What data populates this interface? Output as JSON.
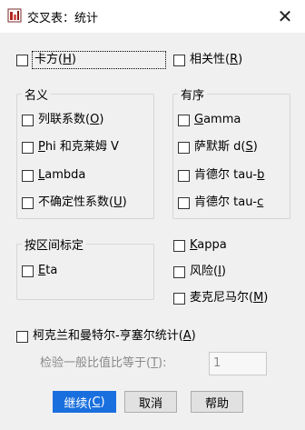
{
  "window": {
    "title": "交叉表：统计",
    "icon": "spss-app-icon"
  },
  "options": {
    "chisq": {
      "text": "卡方(",
      "key": "H",
      "suffix": ")"
    },
    "corr": {
      "text": "相关性(",
      "key": "R",
      "suffix": ")"
    }
  },
  "nominal": {
    "legend": "名义",
    "items": [
      {
        "pre": "列联系数(",
        "key": "O",
        "post": ")"
      },
      {
        "pre": "",
        "key": "P",
        "post": "hi 和克莱姆 V"
      },
      {
        "pre": "",
        "key": "L",
        "post": "ambda"
      },
      {
        "pre": "不确定性系数(",
        "key": "U",
        "post": ")"
      }
    ]
  },
  "ordinal": {
    "legend": "有序",
    "items": [
      {
        "pre": "",
        "key": "G",
        "post": "amma"
      },
      {
        "pre": "萨默斯 d(",
        "key": "S",
        "post": ")"
      },
      {
        "pre": "肯德尔 tau-",
        "key": "b",
        "post": ""
      },
      {
        "pre": "肯德尔 tau-",
        "key": "c",
        "post": ""
      }
    ]
  },
  "interval": {
    "legend": "按区间标定",
    "items": [
      {
        "pre": "",
        "key": "E",
        "post": "ta"
      }
    ]
  },
  "extra": {
    "items": [
      {
        "pre": "",
        "key": "K",
        "post": "appa"
      },
      {
        "pre": "风险(",
        "key": "I",
        "post": ")"
      },
      {
        "pre": "麦克尼马尔(",
        "key": "M",
        "post": ")"
      }
    ]
  },
  "cmh": {
    "label_pre": "柯克兰和曼特尔-亨塞尔统计(",
    "label_key": "A",
    "label_post": ")",
    "test_label_pre": "检验一般比值比等于(",
    "test_label_key": "T",
    "test_label_post": "):",
    "test_value": "1"
  },
  "buttons": {
    "continue": {
      "pre": "继续(",
      "key": "C",
      "post": ")"
    },
    "cancel": "取消",
    "help": "帮助"
  },
  "colors": {
    "primary": "#1a6fde",
    "background": "#f0f0f0",
    "titlebar": "#ffffff"
  }
}
